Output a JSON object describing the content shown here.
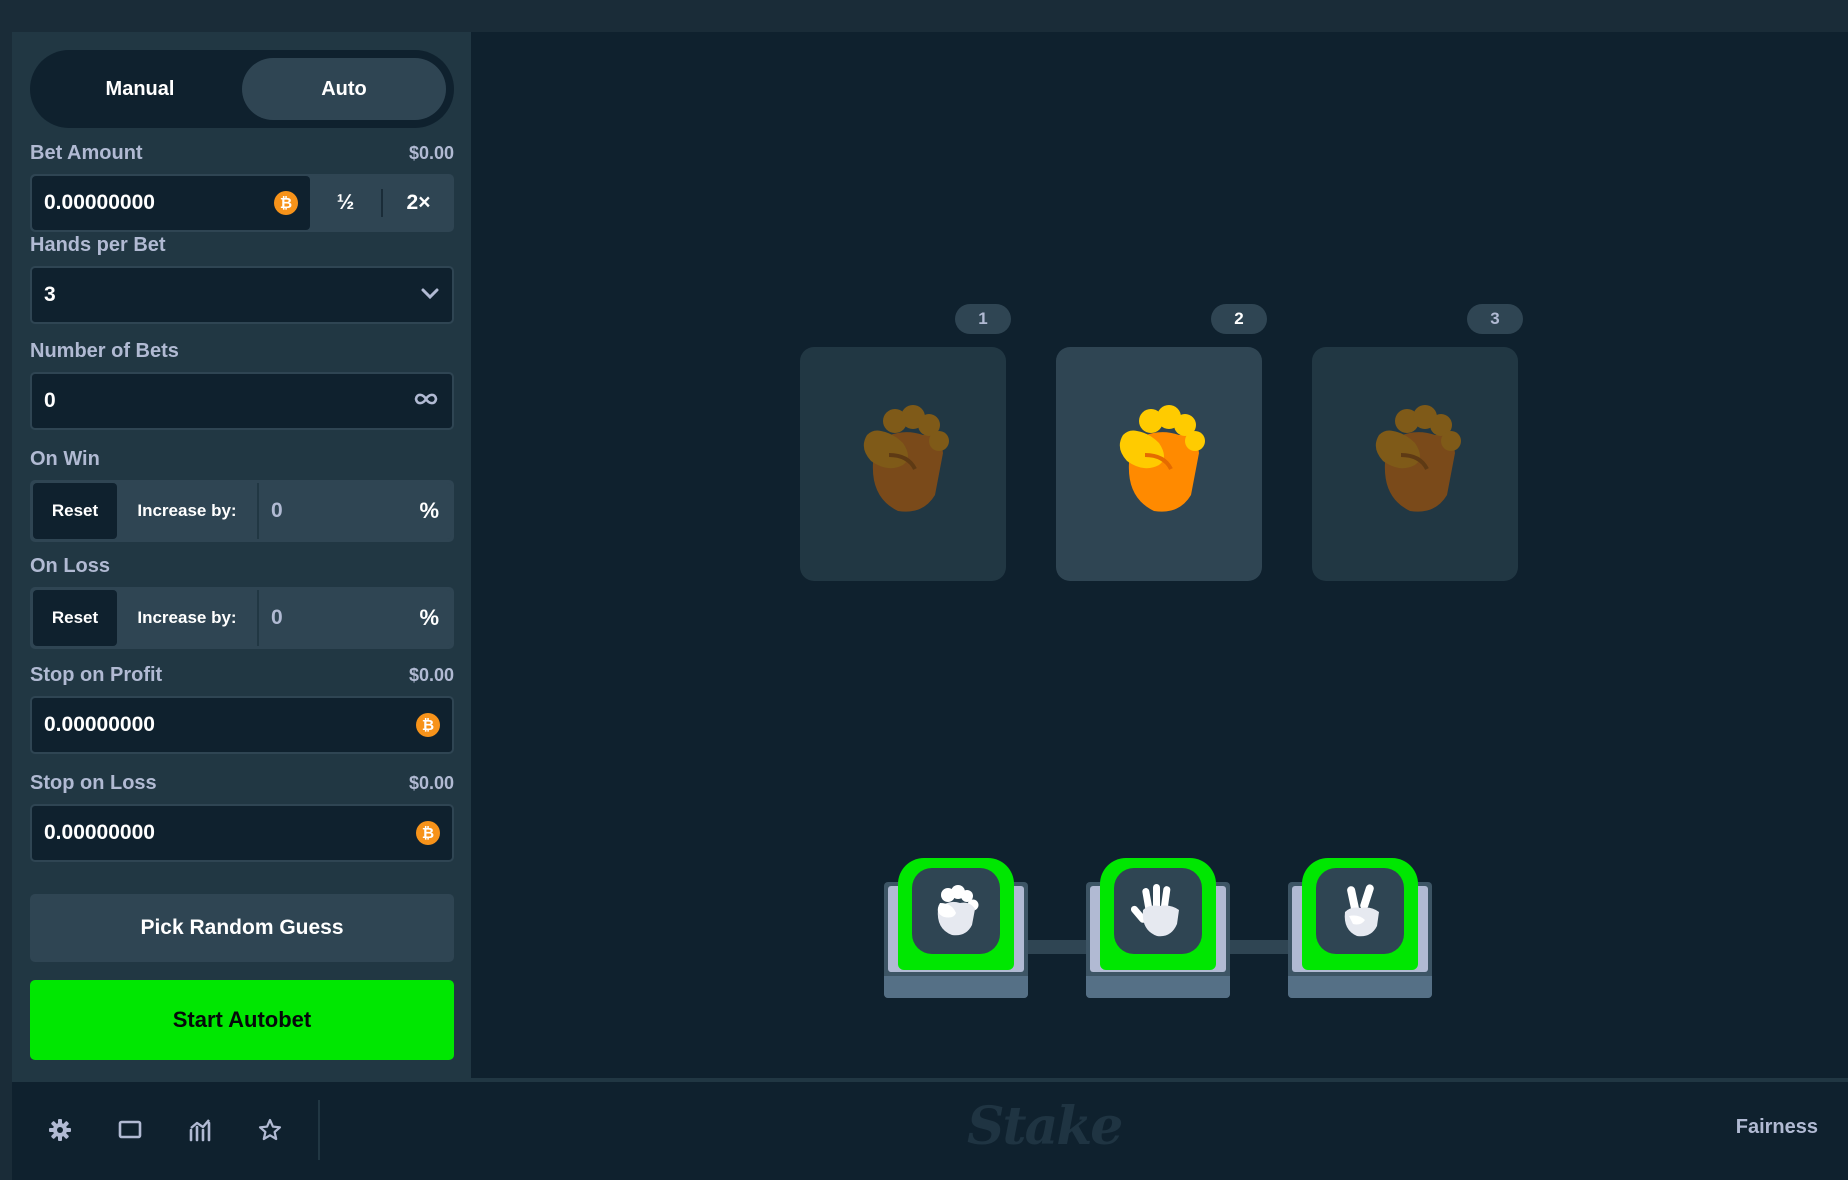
{
  "tabs": {
    "manual": "Manual",
    "auto": "Auto"
  },
  "bet_amount": {
    "label": "Bet Amount",
    "usd": "$0.00",
    "value": "0.00000000",
    "half": "½",
    "double": "2×"
  },
  "hands_per_bet": {
    "label": "Hands per Bet",
    "value": "3"
  },
  "number_of_bets": {
    "label": "Number of Bets",
    "value": "0"
  },
  "on_win": {
    "label": "On Win",
    "reset": "Reset",
    "increase": "Increase by:",
    "value": "0",
    "unit": "%"
  },
  "on_loss": {
    "label": "On Loss",
    "reset": "Reset",
    "increase": "Increase by:",
    "value": "0",
    "unit": "%"
  },
  "stop_on_profit": {
    "label": "Stop on Profit",
    "usd": "$0.00",
    "value": "0.00000000"
  },
  "stop_on_loss": {
    "label": "Stop on Loss",
    "usd": "$0.00",
    "value": "0.00000000"
  },
  "pick_random": "Pick Random Guess",
  "start_autobet": "Start Autobet",
  "hands": [
    {
      "number": "1",
      "gesture": "rock-fist-icon",
      "active": false
    },
    {
      "number": "2",
      "gesture": "rock-fist-icon",
      "active": true
    },
    {
      "number": "3",
      "gesture": "rock-fist-icon",
      "active": false
    }
  ],
  "picks": [
    {
      "gesture": "rock-icon"
    },
    {
      "gesture": "paper-icon"
    },
    {
      "gesture": "scissors-icon"
    }
  ],
  "footer": {
    "icons": [
      "gear-icon",
      "theatre-mode-icon",
      "stats-icon",
      "star-icon"
    ],
    "logo": "Stake",
    "fairness": "Fairness"
  },
  "colors": {
    "accent_green": "#00e701",
    "bitcoin": "#f7931a",
    "panel": "#213743",
    "game_bg": "#0f212e"
  }
}
